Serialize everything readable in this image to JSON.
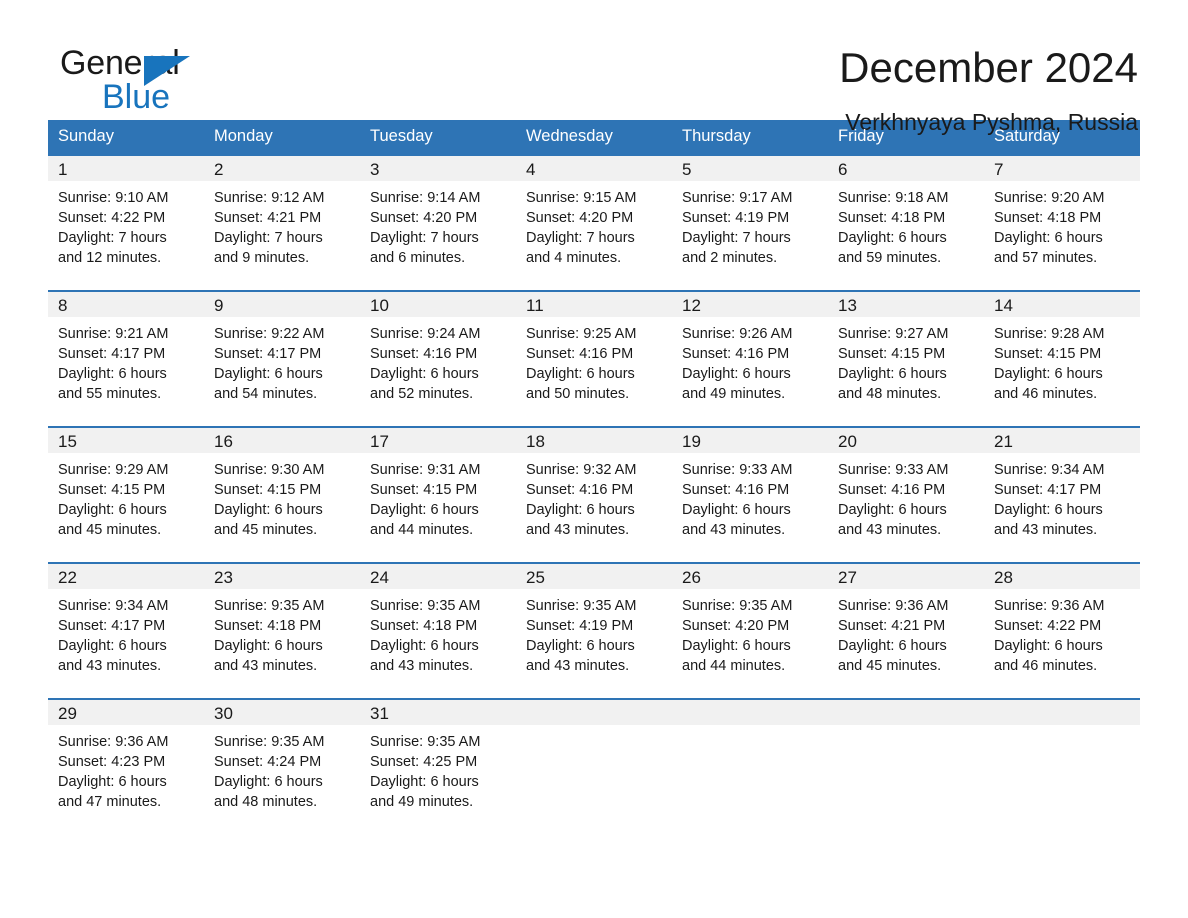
{
  "brand": {
    "name_part1": "General",
    "name_part2": "Blue",
    "triangle_icon": "brand-triangle-icon",
    "accent_color": "#1874bd"
  },
  "header": {
    "month_title": "December 2024",
    "location": "Verkhnyaya Pyshma, Russia",
    "header_bg_color": "#2e74b5",
    "header_text_color": "#ffffff",
    "daynum_band_color": "#f1f1f1"
  },
  "weekday_headers": [
    "Sunday",
    "Monday",
    "Tuesday",
    "Wednesday",
    "Thursday",
    "Friday",
    "Saturday"
  ],
  "weeks": [
    {
      "days": [
        {
          "date": "1",
          "sunrise": "Sunrise: 9:10 AM",
          "sunset": "Sunset: 4:22 PM",
          "daylight_line1": "Daylight: 7 hours",
          "daylight_line2": "and 12 minutes."
        },
        {
          "date": "2",
          "sunrise": "Sunrise: 9:12 AM",
          "sunset": "Sunset: 4:21 PM",
          "daylight_line1": "Daylight: 7 hours",
          "daylight_line2": "and 9 minutes."
        },
        {
          "date": "3",
          "sunrise": "Sunrise: 9:14 AM",
          "sunset": "Sunset: 4:20 PM",
          "daylight_line1": "Daylight: 7 hours",
          "daylight_line2": "and 6 minutes."
        },
        {
          "date": "4",
          "sunrise": "Sunrise: 9:15 AM",
          "sunset": "Sunset: 4:20 PM",
          "daylight_line1": "Daylight: 7 hours",
          "daylight_line2": "and 4 minutes."
        },
        {
          "date": "5",
          "sunrise": "Sunrise: 9:17 AM",
          "sunset": "Sunset: 4:19 PM",
          "daylight_line1": "Daylight: 7 hours",
          "daylight_line2": "and 2 minutes."
        },
        {
          "date": "6",
          "sunrise": "Sunrise: 9:18 AM",
          "sunset": "Sunset: 4:18 PM",
          "daylight_line1": "Daylight: 6 hours",
          "daylight_line2": "and 59 minutes."
        },
        {
          "date": "7",
          "sunrise": "Sunrise: 9:20 AM",
          "sunset": "Sunset: 4:18 PM",
          "daylight_line1": "Daylight: 6 hours",
          "daylight_line2": "and 57 minutes."
        }
      ]
    },
    {
      "days": [
        {
          "date": "8",
          "sunrise": "Sunrise: 9:21 AM",
          "sunset": "Sunset: 4:17 PM",
          "daylight_line1": "Daylight: 6 hours",
          "daylight_line2": "and 55 minutes."
        },
        {
          "date": "9",
          "sunrise": "Sunrise: 9:22 AM",
          "sunset": "Sunset: 4:17 PM",
          "daylight_line1": "Daylight: 6 hours",
          "daylight_line2": "and 54 minutes."
        },
        {
          "date": "10",
          "sunrise": "Sunrise: 9:24 AM",
          "sunset": "Sunset: 4:16 PM",
          "daylight_line1": "Daylight: 6 hours",
          "daylight_line2": "and 52 minutes."
        },
        {
          "date": "11",
          "sunrise": "Sunrise: 9:25 AM",
          "sunset": "Sunset: 4:16 PM",
          "daylight_line1": "Daylight: 6 hours",
          "daylight_line2": "and 50 minutes."
        },
        {
          "date": "12",
          "sunrise": "Sunrise: 9:26 AM",
          "sunset": "Sunset: 4:16 PM",
          "daylight_line1": "Daylight: 6 hours",
          "daylight_line2": "and 49 minutes."
        },
        {
          "date": "13",
          "sunrise": "Sunrise: 9:27 AM",
          "sunset": "Sunset: 4:15 PM",
          "daylight_line1": "Daylight: 6 hours",
          "daylight_line2": "and 48 minutes."
        },
        {
          "date": "14",
          "sunrise": "Sunrise: 9:28 AM",
          "sunset": "Sunset: 4:15 PM",
          "daylight_line1": "Daylight: 6 hours",
          "daylight_line2": "and 46 minutes."
        }
      ]
    },
    {
      "days": [
        {
          "date": "15",
          "sunrise": "Sunrise: 9:29 AM",
          "sunset": "Sunset: 4:15 PM",
          "daylight_line1": "Daylight: 6 hours",
          "daylight_line2": "and 45 minutes."
        },
        {
          "date": "16",
          "sunrise": "Sunrise: 9:30 AM",
          "sunset": "Sunset: 4:15 PM",
          "daylight_line1": "Daylight: 6 hours",
          "daylight_line2": "and 45 minutes."
        },
        {
          "date": "17",
          "sunrise": "Sunrise: 9:31 AM",
          "sunset": "Sunset: 4:15 PM",
          "daylight_line1": "Daylight: 6 hours",
          "daylight_line2": "and 44 minutes."
        },
        {
          "date": "18",
          "sunrise": "Sunrise: 9:32 AM",
          "sunset": "Sunset: 4:16 PM",
          "daylight_line1": "Daylight: 6 hours",
          "daylight_line2": "and 43 minutes."
        },
        {
          "date": "19",
          "sunrise": "Sunrise: 9:33 AM",
          "sunset": "Sunset: 4:16 PM",
          "daylight_line1": "Daylight: 6 hours",
          "daylight_line2": "and 43 minutes."
        },
        {
          "date": "20",
          "sunrise": "Sunrise: 9:33 AM",
          "sunset": "Sunset: 4:16 PM",
          "daylight_line1": "Daylight: 6 hours",
          "daylight_line2": "and 43 minutes."
        },
        {
          "date": "21",
          "sunrise": "Sunrise: 9:34 AM",
          "sunset": "Sunset: 4:17 PM",
          "daylight_line1": "Daylight: 6 hours",
          "daylight_line2": "and 43 minutes."
        }
      ]
    },
    {
      "days": [
        {
          "date": "22",
          "sunrise": "Sunrise: 9:34 AM",
          "sunset": "Sunset: 4:17 PM",
          "daylight_line1": "Daylight: 6 hours",
          "daylight_line2": "and 43 minutes."
        },
        {
          "date": "23",
          "sunrise": "Sunrise: 9:35 AM",
          "sunset": "Sunset: 4:18 PM",
          "daylight_line1": "Daylight: 6 hours",
          "daylight_line2": "and 43 minutes."
        },
        {
          "date": "24",
          "sunrise": "Sunrise: 9:35 AM",
          "sunset": "Sunset: 4:18 PM",
          "daylight_line1": "Daylight: 6 hours",
          "daylight_line2": "and 43 minutes."
        },
        {
          "date": "25",
          "sunrise": "Sunrise: 9:35 AM",
          "sunset": "Sunset: 4:19 PM",
          "daylight_line1": "Daylight: 6 hours",
          "daylight_line2": "and 43 minutes."
        },
        {
          "date": "26",
          "sunrise": "Sunrise: 9:35 AM",
          "sunset": "Sunset: 4:20 PM",
          "daylight_line1": "Daylight: 6 hours",
          "daylight_line2": "and 44 minutes."
        },
        {
          "date": "27",
          "sunrise": "Sunrise: 9:36 AM",
          "sunset": "Sunset: 4:21 PM",
          "daylight_line1": "Daylight: 6 hours",
          "daylight_line2": "and 45 minutes."
        },
        {
          "date": "28",
          "sunrise": "Sunrise: 9:36 AM",
          "sunset": "Sunset: 4:22 PM",
          "daylight_line1": "Daylight: 6 hours",
          "daylight_line2": "and 46 minutes."
        }
      ]
    },
    {
      "days": [
        {
          "date": "29",
          "sunrise": "Sunrise: 9:36 AM",
          "sunset": "Sunset: 4:23 PM",
          "daylight_line1": "Daylight: 6 hours",
          "daylight_line2": "and 47 minutes."
        },
        {
          "date": "30",
          "sunrise": "Sunrise: 9:35 AM",
          "sunset": "Sunset: 4:24 PM",
          "daylight_line1": "Daylight: 6 hours",
          "daylight_line2": "and 48 minutes."
        },
        {
          "date": "31",
          "sunrise": "Sunrise: 9:35 AM",
          "sunset": "Sunset: 4:25 PM",
          "daylight_line1": "Daylight: 6 hours",
          "daylight_line2": "and 49 minutes."
        },
        {
          "date": "",
          "sunrise": "",
          "sunset": "",
          "daylight_line1": "",
          "daylight_line2": ""
        },
        {
          "date": "",
          "sunrise": "",
          "sunset": "",
          "daylight_line1": "",
          "daylight_line2": ""
        },
        {
          "date": "",
          "sunrise": "",
          "sunset": "",
          "daylight_line1": "",
          "daylight_line2": ""
        },
        {
          "date": "",
          "sunrise": "",
          "sunset": "",
          "daylight_line1": "",
          "daylight_line2": ""
        }
      ]
    }
  ]
}
